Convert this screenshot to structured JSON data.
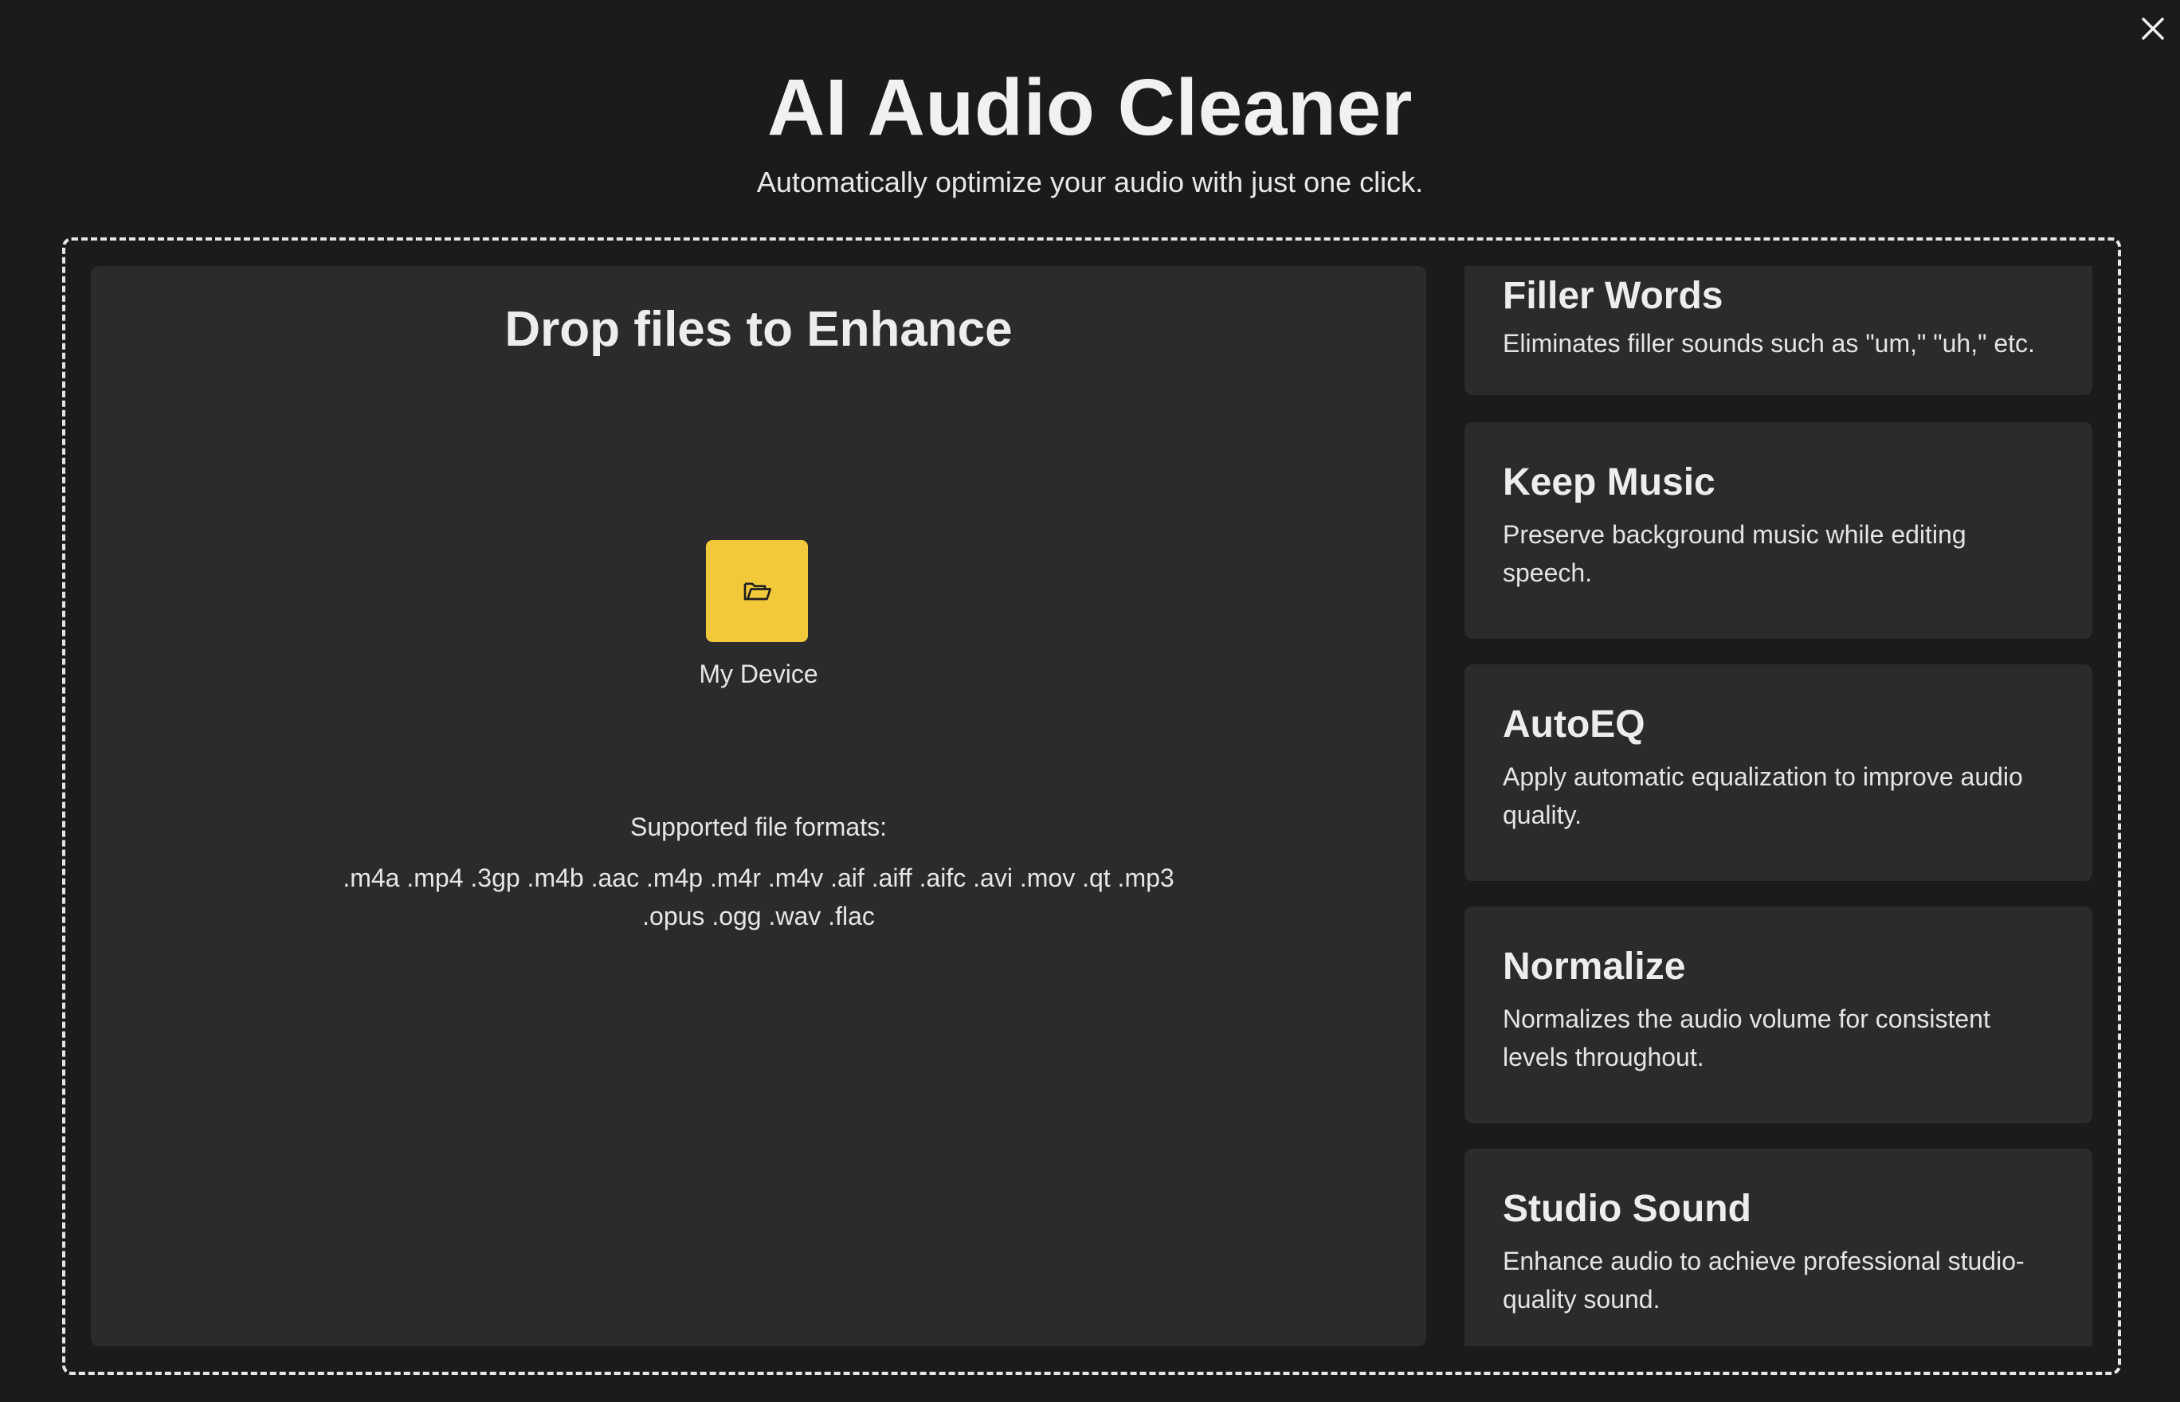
{
  "header": {
    "title": "AI Audio Cleaner",
    "subtitle": "Automatically optimize your audio with just one click."
  },
  "dropzone": {
    "title": "Drop files to Enhance",
    "device_label": "My Device",
    "formats_heading": "Supported file formats:",
    "formats_line1": ".m4a .mp4 .3gp .m4b .aac .m4p .m4r .m4v .aif .aiff .aifc .avi .mov .qt .mp3",
    "formats_line2": ".opus .ogg .wav .flac",
    "button_color": "#f2c93b"
  },
  "features": [
    {
      "title": "Filler Words",
      "desc": "Eliminates filler sounds such as \"um,\" \"uh,\" etc."
    },
    {
      "title": "Keep Music",
      "desc": "Preserve background music while editing speech."
    },
    {
      "title": "AutoEQ",
      "desc": "Apply automatic equalization to improve audio quality."
    },
    {
      "title": "Normalize",
      "desc": "Normalizes the audio volume for consistent levels throughout."
    },
    {
      "title": "Studio Sound",
      "desc": "Enhance audio to achieve professional studio-quality sound."
    }
  ],
  "icons": {
    "close": "close-icon",
    "device": "folder-open-icon"
  }
}
